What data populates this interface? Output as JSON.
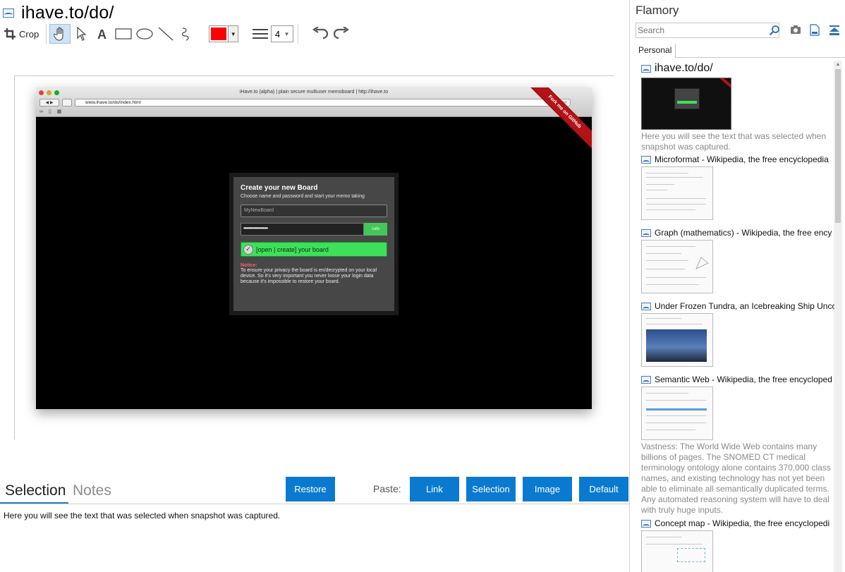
{
  "page": {
    "title": "ihave.to/do/"
  },
  "toolbar": {
    "crop_label": "Crop",
    "color": "#ff0000",
    "line_width": "4"
  },
  "snapshot": {
    "browser_title": "iHave.to (alpha) | plain secure multiuser memoboard | http://ihave.to",
    "address": "www.ihave.to/do/index.html",
    "reader": "Reader",
    "ribbon": "Fork me on GitHub",
    "dialog": {
      "title": "Create your new Board",
      "subtitle": "Choose name and password and start your memo taking",
      "name_placeholder": "MyNewBoard",
      "password_mask": "•••••••••••••••••••",
      "safe_label": "safe",
      "open_label": "[open | create] your board",
      "notice_label": "Notice:",
      "notice_text": "To ensure your privacy the board is en/decrypted on your local device. So it's very important you never loose your login data because it's impossible to restore your board."
    }
  },
  "bottom": {
    "tab_selection": "Selection",
    "tab_notes": "Notes",
    "restore": "Restore",
    "paste_label": "Paste:",
    "paste_link": "Link",
    "paste_selection": "Selection",
    "paste_image": "Image",
    "paste_default": "Default",
    "selection_text": "Here you will see the text that was selected when snapshot was captured."
  },
  "sidebar": {
    "app_title": "Flamory",
    "search_placeholder": "Search",
    "tab_personal": "Personal",
    "entries": [
      {
        "title": "ihave.to/do/",
        "desc": "Here you will see the text that was selected when snapshot was captured."
      },
      {
        "title": "Microformat - Wikipedia, the free encyclopedia",
        "desc": ""
      },
      {
        "title": "Graph (mathematics) - Wikipedia, the free ency",
        "desc": ""
      },
      {
        "title": "Under Frozen Tundra, an Icebreaking Ship Unco",
        "desc": ""
      },
      {
        "title": "Semantic Web - Wikipedia, the free encycloped",
        "desc": "Vastness: The World Wide Web contains many billions of pages. The SNOMED CT medical terminology ontology alone contains 370,000 class names, and existing technology has not yet been able to eliminate all semantically duplicated terms. Any automated reasoning system will have to deal with truly huge inputs."
      },
      {
        "title": "Concept map - Wikipedia, the free encyclopedi",
        "desc": ""
      }
    ]
  }
}
